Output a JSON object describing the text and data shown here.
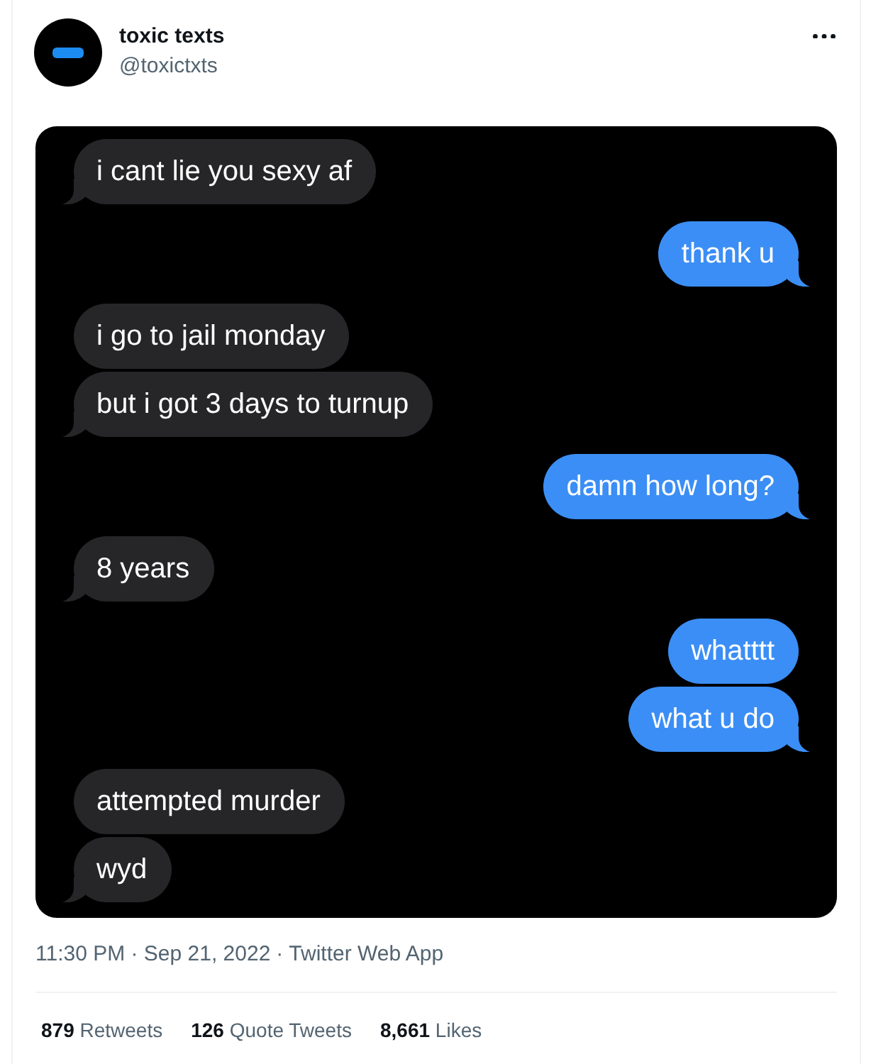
{
  "author": {
    "name": "toxic texts",
    "handle": "@toxictxts"
  },
  "chat_image": {
    "messages": [
      {
        "kind": "received",
        "text": "i cant lie you sexy af"
      },
      {
        "kind": "sent",
        "text": "thank u"
      },
      {
        "kind": "received",
        "text": "i go to jail monday"
      },
      {
        "kind": "received",
        "text": "but i got 3 days to turnup"
      },
      {
        "kind": "sent",
        "text": "damn how long?"
      },
      {
        "kind": "received",
        "text": "8 years"
      },
      {
        "kind": "sent",
        "text": "whatttt"
      },
      {
        "kind": "sent",
        "text": "what u do"
      },
      {
        "kind": "received",
        "text": "attempted murder"
      },
      {
        "kind": "received",
        "text": "wyd"
      }
    ]
  },
  "meta": {
    "timestamp": "11:30 PM · Sep 21, 2022",
    "separator": "·",
    "source": "Twitter Web App"
  },
  "stats": [
    {
      "count": "879",
      "label": "Retweets"
    },
    {
      "count": "126",
      "label": "Quote Tweets"
    },
    {
      "count": "8,661",
      "label": "Likes"
    }
  ]
}
